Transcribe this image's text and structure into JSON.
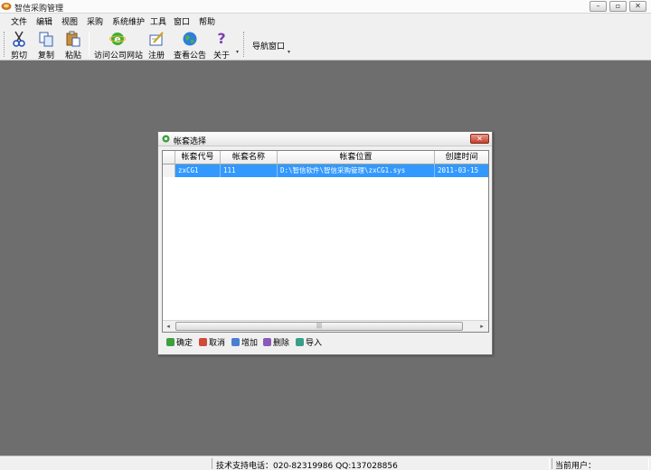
{
  "window": {
    "title": "智信采购管理",
    "minimize_glyph": "–",
    "maximize_glyph": "▫",
    "close_glyph": "✕"
  },
  "menu": [
    "文件",
    "编辑",
    "视图",
    "采购",
    "系统维护",
    "工具",
    "窗口",
    "帮助"
  ],
  "toolbar": {
    "cut": "剪切",
    "copy": "复制",
    "paste": "粘贴",
    "visit_site": "访问公司网站",
    "register": "注册",
    "announcement": "查看公告",
    "about": "关于",
    "about_glyph": "?",
    "more_glyph": "▾",
    "nav_window": "导航窗口"
  },
  "dialog": {
    "title": "帐套选择",
    "close_glyph": "✕",
    "columns": [
      "帐套代号",
      "帐套名称",
      "帐套位置",
      "创建时间"
    ],
    "rows": [
      [
        "zxCG1",
        "111",
        "D:\\智信软件\\智信采购管理\\zxCG1.sys",
        "2011-03-15"
      ]
    ],
    "scroll_left": "◂",
    "scroll_right": "▸",
    "scroll_thumb_grip": "|||",
    "actions": {
      "ok": "确定",
      "cancel": "取消",
      "add": "增加",
      "delete": "删除",
      "import": "导入"
    }
  },
  "status": {
    "support": "技术支持电话：020-82319986 QQ:137028856",
    "current_user": "当前用户："
  },
  "colors": {
    "desktop": "#6e6e6e",
    "selection": "#3399ff",
    "close_button": "#c4402e"
  }
}
